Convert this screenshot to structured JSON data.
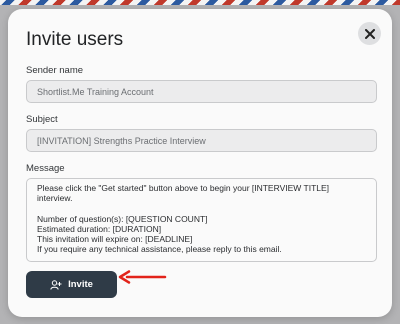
{
  "modal": {
    "title": "Invite users",
    "close_icon": "close-icon",
    "sender_label": "Sender name",
    "sender_value": "Shortlist.Me Training Account",
    "subject_label": "Subject",
    "subject_value": "[INVITATION] Strengths Practice Interview",
    "message_label": "Message",
    "message_lines": [
      "Please click the \"Get started\" button above to begin your [INTERVIEW TITLE] interview.",
      "",
      "Number of question(s): [QUESTION COUNT]",
      "Estimated duration: [DURATION]",
      "This invitation will expire on: [DEADLINE]",
      "If you require any technical assistance, please reply to this email."
    ],
    "invite_label": "Invite",
    "invite_icon": "add-user-icon"
  },
  "colors": {
    "button_bg": "#2f3b47",
    "arrow": "#e2231a"
  }
}
